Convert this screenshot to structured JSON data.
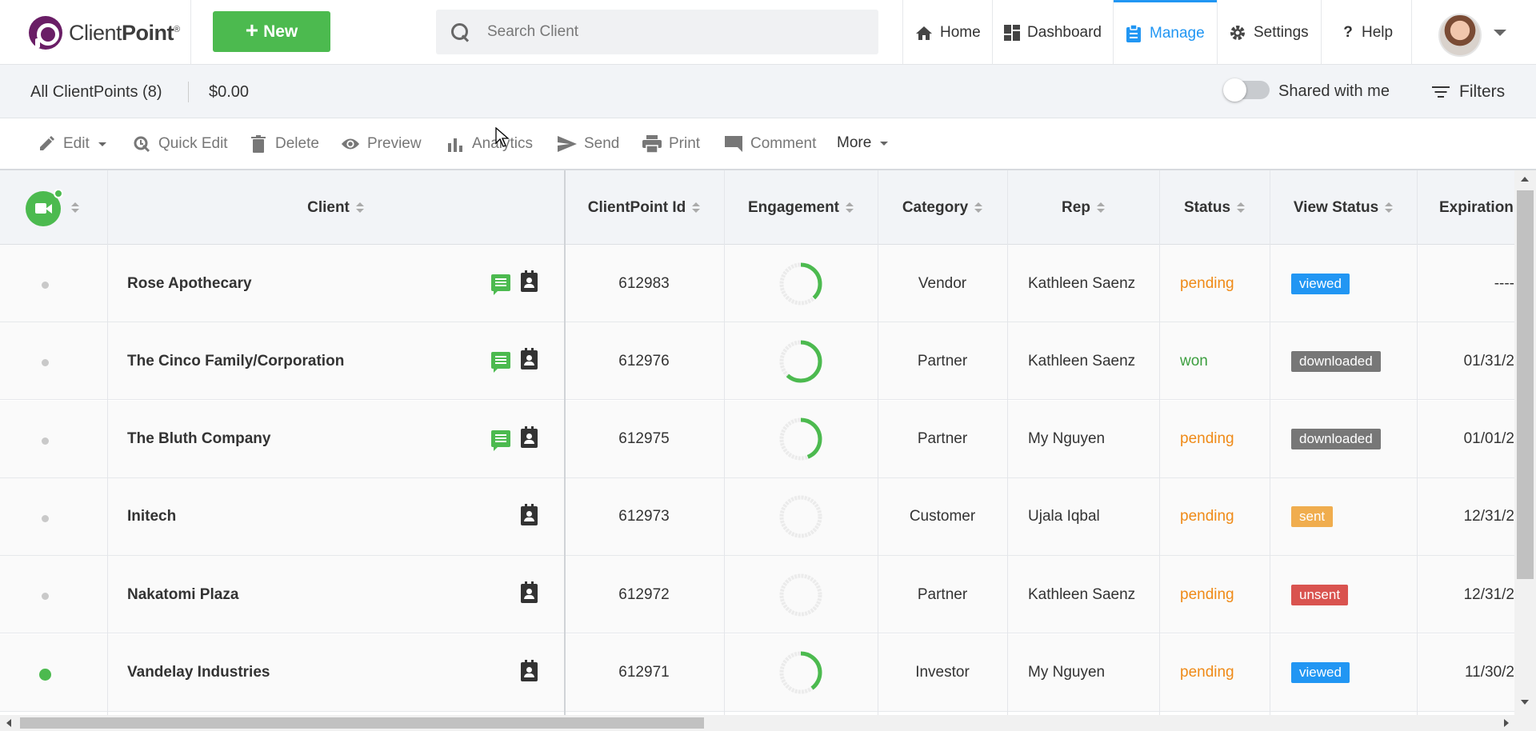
{
  "header": {
    "logo_text_light": "Client",
    "logo_text_bold": "Point",
    "logo_reg": "®",
    "new_button": "New",
    "search_placeholder": "Search Client",
    "nav": [
      {
        "label": "Home",
        "icon": "home-icon"
      },
      {
        "label": "Dashboard",
        "icon": "dashboard-icon"
      },
      {
        "label": "Manage",
        "icon": "clipboard-icon",
        "active": true
      },
      {
        "label": "Settings",
        "icon": "gear-icon"
      },
      {
        "label": "Help",
        "icon": "help-icon"
      }
    ],
    "accent_color": "#2196f3",
    "brand_color": "#6a1e66",
    "new_button_color": "#4cba4f"
  },
  "subbar": {
    "title": "All ClientPoints (8)",
    "amount": "$0.00",
    "shared_label": "Shared with me",
    "shared_toggle_on": false,
    "filters_label": "Filters"
  },
  "toolbar": {
    "edit": "Edit",
    "quick_edit": "Quick Edit",
    "delete": "Delete",
    "preview": "Preview",
    "analytics": "Analytics",
    "send": "Send",
    "print": "Print",
    "comment": "Comment",
    "more": "More"
  },
  "table": {
    "columns": [
      "Client",
      "ClientPoint Id",
      "Engagement",
      "Category",
      "Rep",
      "Status",
      "View Status",
      "Expiration"
    ],
    "rows": [
      {
        "client": "Rose Apothecary",
        "id": "612983",
        "engagement": 0.38,
        "category": "Vendor",
        "rep": "Kathleen Saenz",
        "status": "pending",
        "view_status": "viewed",
        "view_color": "#2196f3",
        "expiration": "----",
        "online": false,
        "has_chat": true
      },
      {
        "client": "The Cinco Family/Corporation",
        "id": "612976",
        "engagement": 0.62,
        "category": "Partner",
        "rep": "Kathleen Saenz",
        "status": "won",
        "view_status": "downloaded",
        "view_color": "#777777",
        "expiration": "01/31/2",
        "online": false,
        "has_chat": true
      },
      {
        "client": "The Bluth Company",
        "id": "612975",
        "engagement": 0.44,
        "category": "Partner",
        "rep": "My Nguyen",
        "status": "pending",
        "view_status": "downloaded",
        "view_color": "#777777",
        "expiration": "01/01/2",
        "online": false,
        "has_chat": true
      },
      {
        "client": "Initech",
        "id": "612973",
        "engagement": 0,
        "category": "Customer",
        "rep": "Ujala Iqbal",
        "status": "pending",
        "view_status": "sent",
        "view_color": "#f0ad4e",
        "expiration": "12/31/2",
        "online": false,
        "has_chat": false
      },
      {
        "client": "Nakatomi Plaza",
        "id": "612972",
        "engagement": 0,
        "category": "Partner",
        "rep": "Kathleen Saenz",
        "status": "pending",
        "view_status": "unsent",
        "view_color": "#d9534f",
        "expiration": "12/31/2",
        "online": false,
        "has_chat": false
      },
      {
        "client": "Vandelay Industries",
        "id": "612971",
        "engagement": 0.4,
        "category": "Investor",
        "rep": "My Nguyen",
        "status": "pending",
        "view_status": "viewed",
        "view_color": "#2196f3",
        "expiration": "11/30/2",
        "online": true,
        "has_chat": false
      }
    ]
  }
}
